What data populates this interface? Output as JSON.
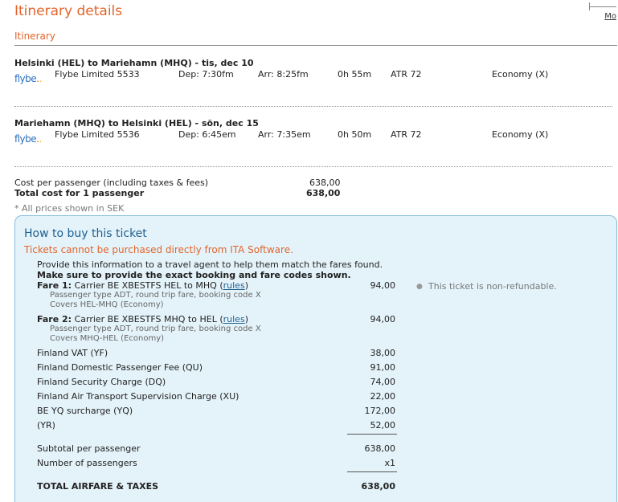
{
  "page": {
    "title": "Itinerary details",
    "section": "Itinerary",
    "more_link": "Mo"
  },
  "segments": [
    {
      "title": "Helsinki (HEL) to Mariehamn (MHQ) - tis, dec 10",
      "carrier_logo": "flybe",
      "flight": "Flybe Limited 5533",
      "dep": "Dep: 7:30fm",
      "arr": "Arr: 8:25fm",
      "duration": "0h 55m",
      "aircraft": "ATR 72",
      "cabin": "Economy (X)"
    },
    {
      "title": "Mariehamn (MHQ) to Helsinki (HEL) - sön, dec 15",
      "carrier_logo": "flybe",
      "flight": "Flybe Limited 5536",
      "dep": "Dep: 6:45em",
      "arr": "Arr: 7:35em",
      "duration": "0h 50m",
      "aircraft": "ATR 72",
      "cabin": "Economy (X)"
    }
  ],
  "costs": {
    "per_passenger_label": "Cost per passenger (including taxes & fees)",
    "per_passenger_value": "638,00",
    "total_label": "Total cost for 1 passenger",
    "total_value": "638,00",
    "currency_note": "* All prices shown in SEK"
  },
  "how_to_buy": {
    "title": "How to buy this ticket",
    "warning": "Tickets cannot be purchased directly from ITA Software.",
    "instruction": "Provide this information to a travel agent to help them match the fares found.",
    "instruction_bold": "Make sure to provide the exact booking and fare codes shown.",
    "fares": [
      {
        "label": "Fare 1:",
        "desc": "Carrier BE XBESTFS HEL to MHQ (",
        "rules": "rules",
        "close": ")",
        "line2": "Passenger type ADT, round trip fare, booking code X",
        "line3": "Covers HEL-MHQ (Economy)",
        "amount": "94,00"
      },
      {
        "label": "Fare 2:",
        "desc": "Carrier BE XBESTFS MHQ to HEL (",
        "rules": "rules",
        "close": ")",
        "line2": "Passenger type ADT, round trip fare, booking code X",
        "line3": "Covers MHQ-HEL (Economy)",
        "amount": "94,00"
      }
    ],
    "taxes": [
      {
        "label": "Finland VAT (YF)",
        "amount": "38,00"
      },
      {
        "label": "Finland Domestic Passenger Fee (QU)",
        "amount": "91,00"
      },
      {
        "label": "Finland Security Charge (DQ)",
        "amount": "74,00"
      },
      {
        "label": "Finland Air Transport Supervision Charge (XU)",
        "amount": "22,00"
      },
      {
        "label": "BE YQ surcharge (YQ)",
        "amount": "172,00"
      },
      {
        "label": "(YR)",
        "amount": "52,00"
      }
    ],
    "subtotal_label": "Subtotal per passenger",
    "subtotal_value": "638,00",
    "passengers_label": "Number of passengers",
    "passengers_value": "x1",
    "total_label": "TOTAL AIRFARE & TAXES",
    "total_value": "638,00",
    "note": "This ticket is non-refundable."
  }
}
